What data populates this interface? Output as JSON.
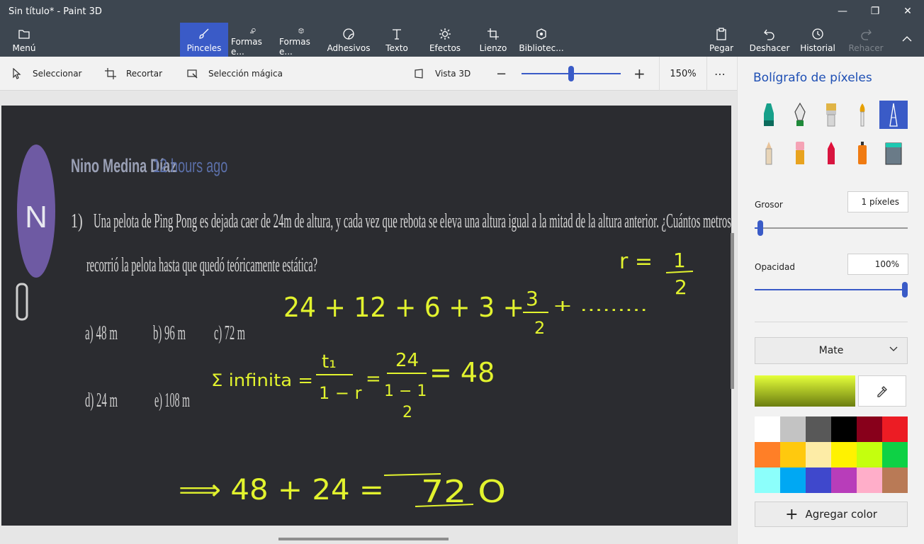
{
  "window": {
    "title": "Sin título* - Paint 3D"
  },
  "toolbar": {
    "menu": "Menú",
    "brushes": "Pinceles",
    "shapes2d": "Formas e...",
    "shapes3d": "Formas e...",
    "stickers": "Adhesivos",
    "text": "Texto",
    "effects": "Efectos",
    "canvas": "Lienzo",
    "library": "Bibliotec...",
    "paste": "Pegar",
    "undo": "Deshacer",
    "history": "Historial",
    "redo": "Rehacer"
  },
  "subbar": {
    "select": "Seleccionar",
    "crop": "Recortar",
    "magic_select": "Selección mágica",
    "view3d": "Vista 3D",
    "zoom": "150%",
    "zoom_level": 0.5
  },
  "panel": {
    "title": "Bolígrafo de píxeles",
    "thickness_label": "Grosor",
    "thickness_value": "1 píxeles",
    "thickness_level": 0.02,
    "opacity_label": "Opacidad",
    "opacity_value": "100%",
    "opacity_level": 1.0,
    "finish": "Mate",
    "add_color": "Agregar color",
    "palette": [
      "#ffffff",
      "#c3c3c3",
      "#585858",
      "#000000",
      "#88001b",
      "#ec1c24",
      "#ff7f27",
      "#ffc90e",
      "#fdeca6",
      "#fff200",
      "#c4ff0e",
      "#0ed145",
      "#8cfffb",
      "#00a8f3",
      "#3f48cc",
      "#b83dba",
      "#ffaec9",
      "#b97a56"
    ]
  },
  "canvas": {
    "avatar_letter": "N",
    "author": "Nino Medina Díaz",
    "time": "12 hours ago",
    "q_number": "1)",
    "q_line1": "Una pelota de Ping Pong es dejada caer de 24m de altura, y cada vez que rebota se eleva una altura igual a la mitad de la altura anterior. ¿Cuántos metros",
    "q_line2": "recorrió la pelota hasta que quedó teóricamente estática?",
    "opt_a": "a) 48 m",
    "opt_b": "b) 96 m",
    "opt_c": "c) 72 m",
    "opt_d": "d) 24 m",
    "opt_e": "e) 108 m"
  },
  "handwriting": {
    "ratio_r": "r =",
    "ratio_num": "1",
    "ratio_den": "2",
    "series": "24 + 12 + 6 + 3 +",
    "series_frac_num": "3",
    "series_frac_den": "2",
    "series_tail": "+ .........",
    "sum_label": "Σ infinita =",
    "sum_num": "t₁",
    "sum_den": "1 − r",
    "eq_num": "24",
    "eq_den": "1 − 1",
    "eq_den2": "2",
    "eq_result": "= 48",
    "final": "⟹ 48 + 24 =",
    "final_result": "72 O"
  },
  "colors": {
    "accent": "#3a5bc7",
    "ink": "#e2f32e",
    "topbar": "#3d4650"
  }
}
